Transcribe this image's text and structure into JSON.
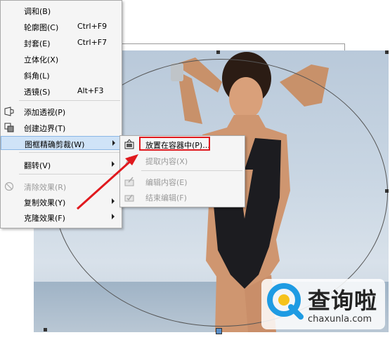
{
  "menu": {
    "items": [
      {
        "label": "调和(B)",
        "shortcut": "",
        "submenu": false,
        "disabled": false,
        "icon": ""
      },
      {
        "label": "轮廓图(C)",
        "shortcut": "Ctrl+F9",
        "submenu": false,
        "disabled": false,
        "icon": ""
      },
      {
        "label": "封套(E)",
        "shortcut": "Ctrl+F7",
        "submenu": false,
        "disabled": false,
        "icon": ""
      },
      {
        "label": "立体化(X)",
        "shortcut": "",
        "submenu": false,
        "disabled": false,
        "icon": ""
      },
      {
        "label": "斜角(L)",
        "shortcut": "",
        "submenu": false,
        "disabled": false,
        "icon": ""
      },
      {
        "label": "透镜(S)",
        "shortcut": "Alt+F3",
        "submenu": false,
        "disabled": false,
        "icon": ""
      },
      {
        "label": "添加透视(P)",
        "shortcut": "",
        "submenu": false,
        "disabled": false,
        "icon": "perspective-icon"
      },
      {
        "label": "创建边界(T)",
        "shortcut": "",
        "submenu": false,
        "disabled": false,
        "icon": "boundary-icon"
      },
      {
        "label": "图框精确剪裁(W)",
        "shortcut": "",
        "submenu": true,
        "disabled": false,
        "icon": ""
      },
      {
        "label": "翻转(V)",
        "shortcut": "",
        "submenu": true,
        "disabled": false,
        "icon": ""
      },
      {
        "label": "清除效果(R)",
        "shortcut": "",
        "submenu": false,
        "disabled": true,
        "icon": "clear-effect-icon"
      },
      {
        "label": "复制效果(Y)",
        "shortcut": "",
        "submenu": true,
        "disabled": false,
        "icon": ""
      },
      {
        "label": "克隆效果(F)",
        "shortcut": "",
        "submenu": true,
        "disabled": false,
        "icon": ""
      }
    ]
  },
  "submenu": {
    "items": [
      {
        "label": "放置在容器中(P)...",
        "disabled": false,
        "icon": "place-in-container-icon"
      },
      {
        "label": "提取内容(X)",
        "disabled": true,
        "icon": "extract-content-icon"
      },
      {
        "label": "编辑内容(E)",
        "disabled": true,
        "icon": "edit-content-icon"
      },
      {
        "label": "结束编辑(F)",
        "disabled": true,
        "icon": "finish-edit-icon"
      }
    ]
  },
  "watermark": {
    "title": "查询啦",
    "url": "chaxunla.com"
  },
  "colors": {
    "highlight": "#cfe3f7",
    "annotation_red": "#e0191e",
    "watermark_blue": "#1e9be3"
  }
}
